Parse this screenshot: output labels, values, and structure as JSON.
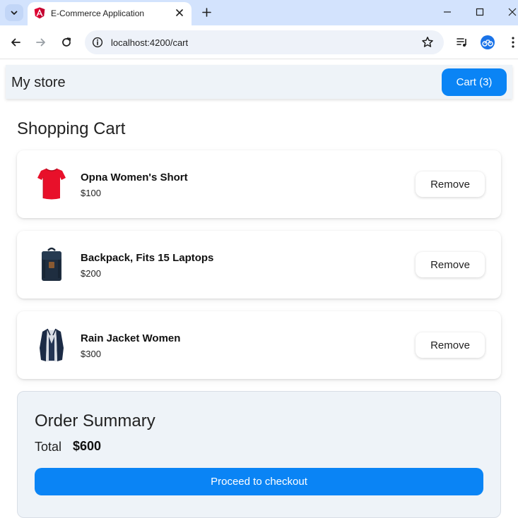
{
  "browser": {
    "tab_title": "E-Commerce Application",
    "url": "localhost:4200/cart",
    "icons": [
      "tab-search-icon",
      "angular-favicon-icon",
      "close-icon",
      "plus-icon",
      "minimize-icon",
      "maximize-icon",
      "close-window-icon",
      "back-arrow-icon",
      "forward-arrow-icon",
      "reload-icon",
      "info-icon",
      "star-icon",
      "media-playlist-icon",
      "profile-avatar-icon",
      "more-vertical-icon"
    ]
  },
  "navbar": {
    "brand": "My store",
    "cart_button": "Cart (3)"
  },
  "cart": {
    "heading": "Shopping Cart",
    "remove_label": "Remove",
    "items": [
      {
        "name": "Opna Women's Short",
        "price": "$100",
        "image": "red-tshirt-icon"
      },
      {
        "name": "Backpack, Fits 15 Laptops",
        "price": "$200",
        "image": "navy-backpack-icon"
      },
      {
        "name": "Rain Jacket Women",
        "price": "$300",
        "image": "navy-jacket-icon"
      }
    ]
  },
  "summary": {
    "title": "Order Summary",
    "total_label": "Total",
    "total_value": "$600",
    "checkout_button": "Proceed to checkout"
  },
  "colors": {
    "primary": "#0a84f5",
    "panel": "#eef3f8",
    "tabstrip": "#d3e3fd"
  }
}
